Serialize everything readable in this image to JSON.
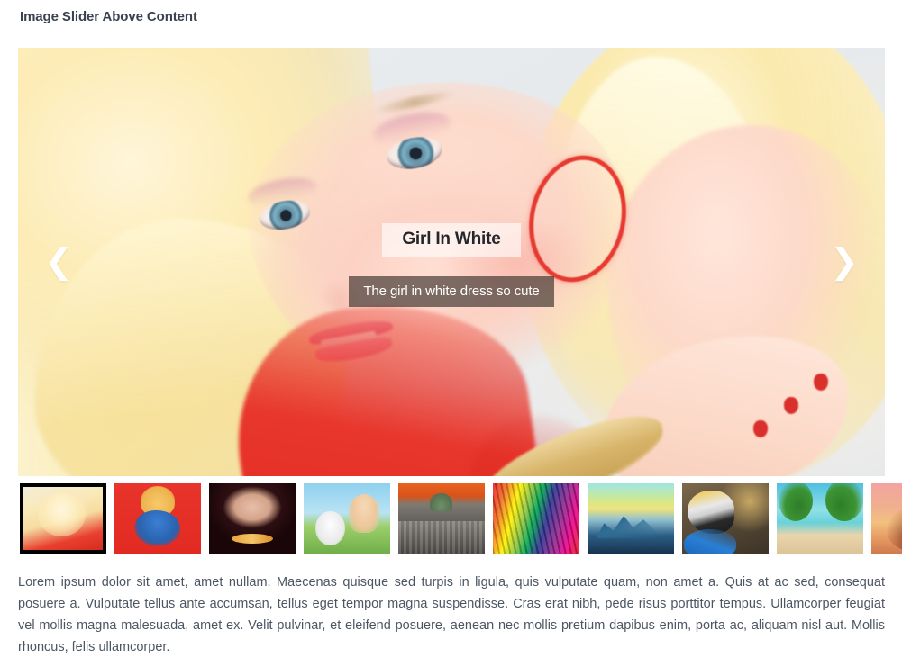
{
  "page": {
    "title": "Image Slider Above Content",
    "background_color": "#ffffff",
    "text_color": "#4c5663"
  },
  "slider": {
    "active_index": 1,
    "total_slides": 10,
    "caption": {
      "title": "Girl In White",
      "description": "The girl in white dress so cute",
      "title_bg": "rgba(255,255,255,0.62)",
      "desc_bg": "rgba(45,38,34,0.62)"
    },
    "controls": {
      "prev_glyph": "❮",
      "prev_label": "Previous slide",
      "next_glyph": "❯",
      "next_label": "Next slide"
    },
    "thumbnails": [
      {
        "label": "Girl In White",
        "active": true
      },
      {
        "label": "Red Character",
        "active": false
      },
      {
        "label": "Dark Portrait",
        "active": false
      },
      {
        "label": "Peanuts",
        "active": false
      },
      {
        "label": "Congress Sunset",
        "active": false
      },
      {
        "label": "Rainbow Waves",
        "active": false
      },
      {
        "label": "Blue Fantasy Landscape",
        "active": false
      },
      {
        "label": "Macaw Parrot",
        "active": false
      },
      {
        "label": "Beach Hammock",
        "active": false
      },
      {
        "label": "Desert Tree Sunset",
        "active": false
      }
    ]
  },
  "content": {
    "paragraph": "Lorem ipsum dolor sit amet, amet nullam. Maecenas quisque sed turpis in ligula, quis vulputate quam, non amet a. Quis at ac sed, consequat posuere a. Vulputate tellus ante accumsan, tellus eget tempor magna suspendisse. Cras erat nibh, pede risus porttitor tempus. Ullamcorper feugiat vel mollis magna malesuada, amet ex. Velit pulvinar, et eleifend posuere, aenean nec mollis pretium dapibus enim, porta ac, aliquam nisl aut. Mollis rhoncus, felis ullamcorper."
  }
}
